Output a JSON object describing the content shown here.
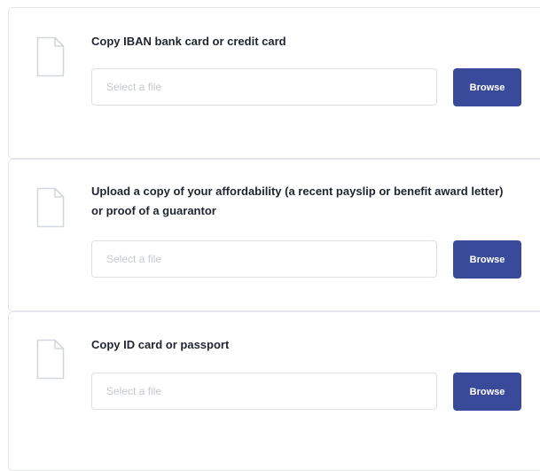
{
  "uploads": [
    {
      "title": "Copy IBAN bank card or credit card",
      "placeholder": "Select a file",
      "button_label": "Browse",
      "icon": "document-icon"
    },
    {
      "title": "Upload a copy of your affordability (a recent payslip or benefit award letter) or proof of a guarantor",
      "placeholder": "Select a file",
      "button_label": "Browse",
      "icon": "document-icon"
    },
    {
      "title": "Copy ID card or passport",
      "placeholder": "Select a file",
      "button_label": "Browse",
      "icon": "document-icon"
    }
  ],
  "colors": {
    "button_bg": "#3a4a9a",
    "card_border": "#e3e5ea",
    "title_text": "#1f2430",
    "placeholder_text": "#c4c8d0"
  }
}
